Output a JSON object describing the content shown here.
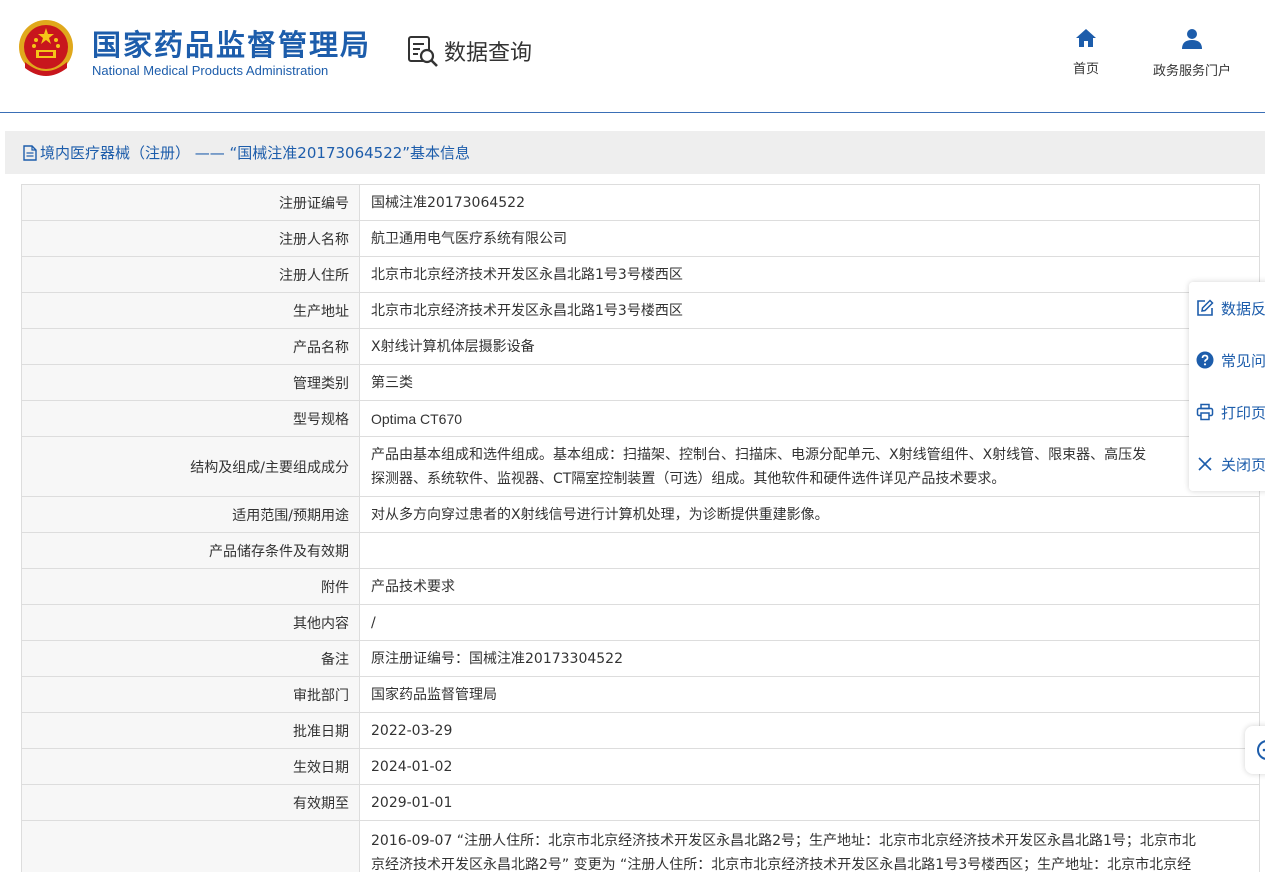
{
  "header": {
    "brand_cn": "国家药品监督管理局",
    "brand_en": "National Medical Products Administration",
    "data_query": "数据查询",
    "nav": {
      "home": "首页",
      "portal": "政务服务门户"
    }
  },
  "page_title": "境内医疗器械（注册） —— “国械注准20173064522”基本信息",
  "rows": [
    {
      "label": "注册证编号",
      "value": "国械注准20173064522"
    },
    {
      "label": "注册人名称",
      "value": "航卫通用电气医疗系统有限公司"
    },
    {
      "label": "注册人住所",
      "value": "北京市北京经济技术开发区永昌北路1号3号楼西区"
    },
    {
      "label": "生产地址",
      "value": "北京市北京经济技术开发区永昌北路1号3号楼西区"
    },
    {
      "label": "产品名称",
      "value": "X射线计算机体层摄影设备"
    },
    {
      "label": "管理类别",
      "value": "第三类"
    },
    {
      "label": "型号规格",
      "value": "Optima CT670"
    },
    {
      "label": "结构及组成/主要组成成分",
      "value": "产品由基本组成和选件组成。基本组成：扫描架、控制台、扫描床、电源分配单元、X射线管组件、X射线管、限束器、高压发生器、探测器、系统软件、监视器、CT隔室控制装置（可选）组成。其他软件和硬件选件详见产品技术要求。",
      "line1": "产品由基本组成和选件组成。基本组成：扫描架、控制台、扫描床、电源分配单元、X射线管组件、X射线管、限束器、高压发",
      "line2": "探测器、系统软件、监视器、CT隔室控制装置（可选）组成。其他软件和硬件选件详见产品技术要求。"
    },
    {
      "label": "适用范围/预期用途",
      "value": "对从多方向穿过患者的X射线信号进行计算机处理，为诊断提供重建影像。"
    },
    {
      "label": "产品储存条件及有效期",
      "value": ""
    },
    {
      "label": "附件",
      "value": "产品技术要求"
    },
    {
      "label": "其他内容",
      "value": "/"
    },
    {
      "label": "备注",
      "value": "原注册证编号：国械注准20173304522"
    },
    {
      "label": "审批部门",
      "value": "国家药品监督管理局"
    },
    {
      "label": "批准日期",
      "value": "2022-03-29"
    },
    {
      "label": "生效日期",
      "value": "2024-01-02"
    },
    {
      "label": "有效期至",
      "value": "2029-01-01"
    },
    {
      "label": "",
      "line1": "2016-09-07 “注册人住所：北京市北京经济技术开发区永昌北路2号；生产地址：北京市北京经济技术开发区永昌北路1号；北京市北",
      "line2": "京经济技术开发区永昌北路2号” 变更为 “注册人住所：北京市北京经济技术开发区永昌北路1号3号楼西区；生产地址：北京市北京经"
    }
  ],
  "float_panel": {
    "items": [
      {
        "label": "数据反",
        "icon": "edit-icon"
      },
      {
        "label": "常见问",
        "icon": "help-icon"
      },
      {
        "label": "打印页",
        "icon": "print-icon"
      },
      {
        "label": "关闭页",
        "icon": "close-icon"
      }
    ]
  },
  "colors": {
    "brand": "#1d5dab",
    "label_bg": "#f7f7f7",
    "border": "#dddddd"
  }
}
